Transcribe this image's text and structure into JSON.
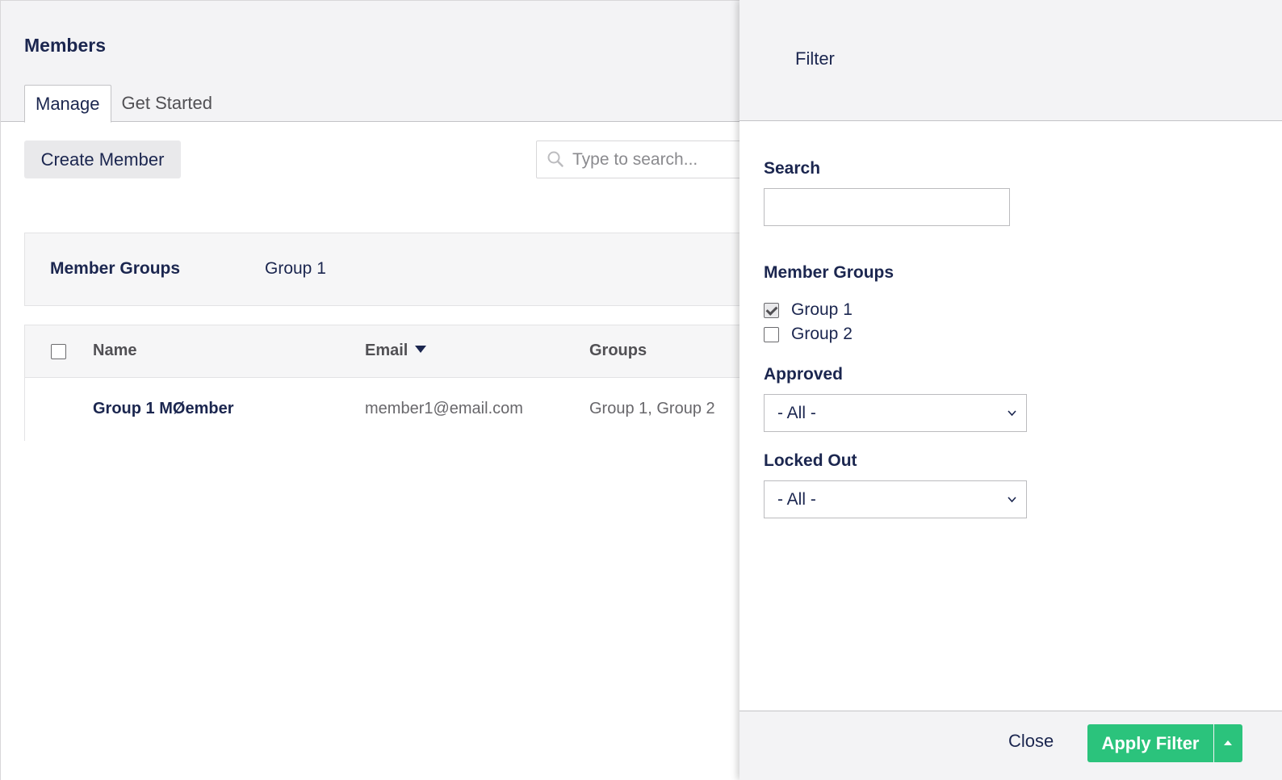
{
  "page": {
    "title": "Members",
    "tabs": [
      {
        "label": "Manage",
        "active": true
      },
      {
        "label": "Get Started",
        "active": false
      }
    ],
    "create_button_label": "Create Member",
    "search": {
      "placeholder": "Type to search...",
      "value": ""
    }
  },
  "groups_bar": {
    "label": "Member Groups",
    "value": "Group 1"
  },
  "table": {
    "columns": [
      "Name",
      "Email",
      "Groups"
    ],
    "sorted_column": "Email",
    "rows": [
      {
        "name": "Group 1 MØember",
        "email": "member1@email.com",
        "groups": "Group 1, Group 2"
      }
    ]
  },
  "filter_panel": {
    "title": "Filter",
    "search_label": "Search",
    "search_value": "",
    "member_groups_label": "Member Groups",
    "member_groups": [
      {
        "label": "Group 1",
        "checked": true
      },
      {
        "label": "Group 2",
        "checked": false
      }
    ],
    "approved_label": "Approved",
    "approved_value": "- All -",
    "locked_out_label": "Locked Out",
    "locked_out_value": "- All -",
    "close_label": "Close",
    "apply_label": "Apply Filter"
  },
  "colors": {
    "primary_text": "#1b264f",
    "apply_green": "#2bc37c",
    "header_bg": "#f3f3f5"
  },
  "icons": {
    "search": "search-icon",
    "sort": "caret-down-icon",
    "select": "chevron-down-icon",
    "apply_options": "caret-up-icon",
    "checkbox_checked": "checkmark-icon"
  }
}
